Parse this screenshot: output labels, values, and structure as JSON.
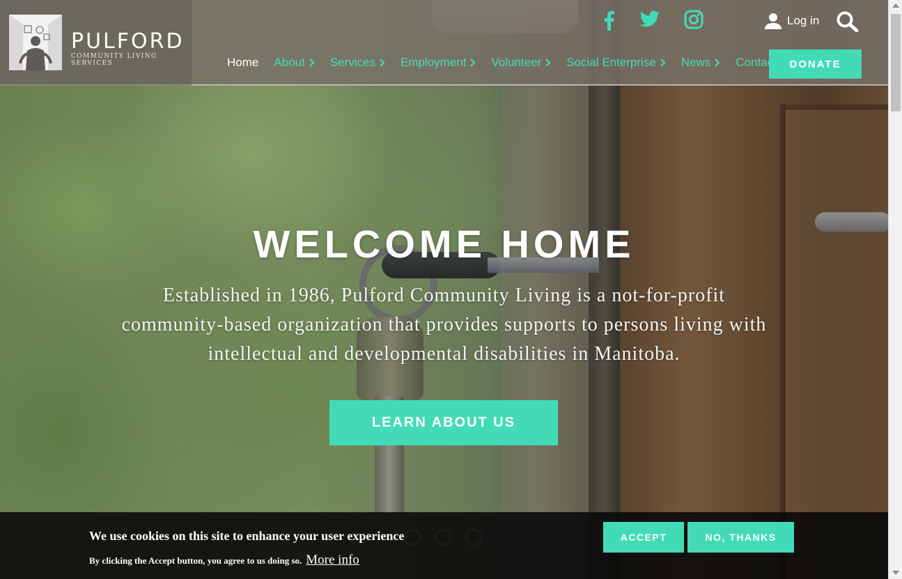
{
  "brand": {
    "name": "PULFORD",
    "tagline": "COMMUNITY LIVING SERVICES"
  },
  "social": [
    "facebook-icon",
    "twitter-icon",
    "instagram-icon"
  ],
  "header": {
    "login_label": "Log in"
  },
  "nav": {
    "items": [
      {
        "label": "Home",
        "active": true
      },
      {
        "label": "About",
        "has_submenu": true
      },
      {
        "label": "Services",
        "has_submenu": true
      },
      {
        "label": "Employment",
        "has_submenu": true
      },
      {
        "label": "Volunteer",
        "has_submenu": true
      },
      {
        "label": "Social Enterprise",
        "has_submenu": true
      },
      {
        "label": "News",
        "has_submenu": true
      },
      {
        "label": "Contact"
      }
    ],
    "donate_label": "DONATE"
  },
  "hero": {
    "title": "WELCOME HOME",
    "text": "Established in 1986, Pulford Community Living is a not-for-profit community-based organization that provides supports to persons living with intellectual and developmental disabilities in Manitoba.",
    "button_label": "LEARN ABOUT US"
  },
  "cookie": {
    "title": "We use cookies on this site to enhance your user experience",
    "text": "By clicking the Accept button, you agree to us doing so.",
    "link_label": "More info",
    "accept_label": "ACCEPT",
    "decline_label": "NO, THANKS"
  },
  "colors": {
    "accent": "#43dbb7",
    "nav_text": "#46ddb5",
    "header_bg": "#78706a",
    "cookie_bg": "#0a0a0a"
  }
}
